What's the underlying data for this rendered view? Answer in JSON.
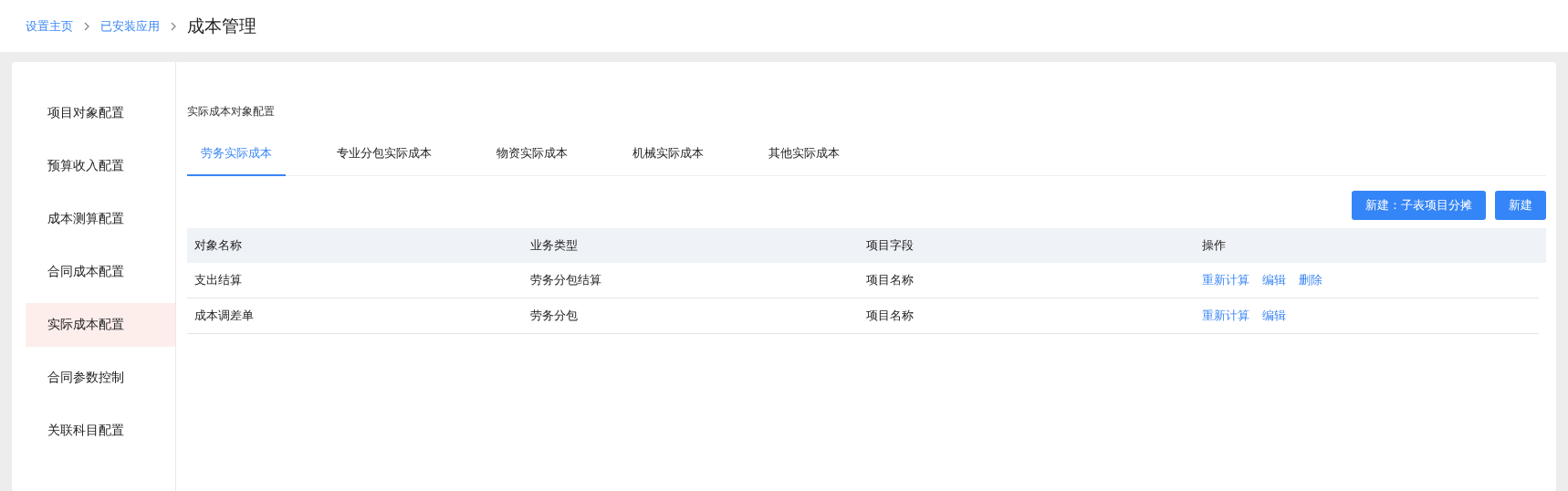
{
  "breadcrumb": [
    {
      "label": "设置主页",
      "link": true
    },
    {
      "label": "已安装应用",
      "link": true
    },
    {
      "label": "成本管理",
      "link": false
    }
  ],
  "sidebar": {
    "items": [
      {
        "label": "项目对象配置",
        "selected": false
      },
      {
        "label": "预算收入配置",
        "selected": false
      },
      {
        "label": "成本测算配置",
        "selected": false
      },
      {
        "label": "合同成本配置",
        "selected": false
      },
      {
        "label": "实际成本配置",
        "selected": true
      },
      {
        "label": "合同参数控制",
        "selected": false
      },
      {
        "label": "关联科目配置",
        "selected": false
      }
    ]
  },
  "section_title": "实际成本对象配置",
  "tabs": [
    {
      "label": "劳务实际成本",
      "selected": true
    },
    {
      "label": "专业分包实际成本",
      "selected": false
    },
    {
      "label": "物资实际成本",
      "selected": false
    },
    {
      "label": "机械实际成本",
      "selected": false
    },
    {
      "label": "其他实际成本",
      "selected": false
    }
  ],
  "buttons": [
    "新建：子表项目分摊",
    "新建"
  ],
  "table": {
    "columns": [
      "对象名称",
      "业务类型",
      "项目字段",
      "操作"
    ],
    "rows": [
      {
        "cells": [
          "支出结算",
          "劳务分包结算",
          "项目名称"
        ],
        "actions": [
          "重新计算",
          "编辑",
          "删除"
        ]
      },
      {
        "cells": [
          "成本调差单",
          "劳务分包",
          "项目名称"
        ],
        "actions": [
          "重新计算",
          "编辑"
        ]
      }
    ]
  }
}
